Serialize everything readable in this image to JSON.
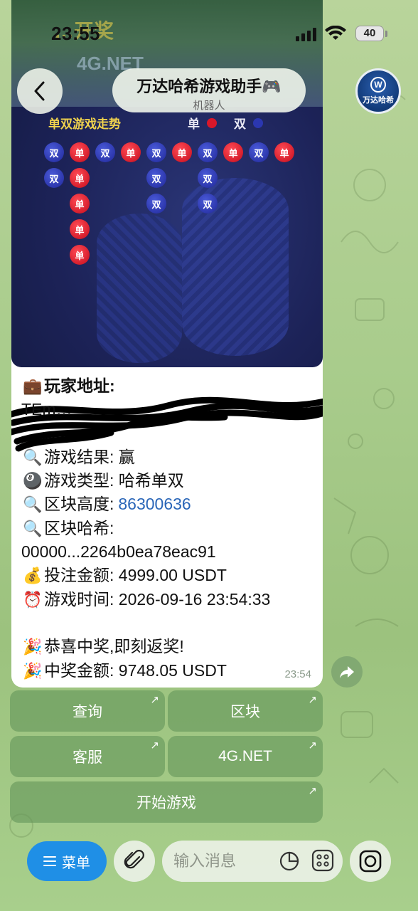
{
  "status": {
    "time": "23:55",
    "battery": "40"
  },
  "header": {
    "title": "万达哈希游戏助手🎮",
    "subtitle": "机器人",
    "avatar_text": "万达哈希"
  },
  "photo": {
    "banner": "…开奖",
    "banner_sub": "4G.NET",
    "trend_title": "单双游戏走势",
    "legend": [
      {
        "label": "单",
        "color": "#d8172a"
      },
      {
        "label": "双",
        "color": "#2b37b0"
      }
    ],
    "columns": [
      [
        "双",
        "双"
      ],
      [
        "单",
        "单",
        "单",
        "单",
        "单"
      ],
      [
        "双"
      ],
      [
        "单"
      ],
      [
        "双",
        "双",
        "双"
      ],
      [
        "单"
      ],
      [
        "双",
        "双",
        "双"
      ],
      [
        "单"
      ],
      [
        "双"
      ],
      [
        "单"
      ]
    ]
  },
  "message": {
    "player_label": "玩家地址:",
    "player_address_partial": "TEm…",
    "result": "游戏结果: 赢",
    "type": "游戏类型: 哈希单双",
    "height_label": "区块高度: ",
    "height": "86300636",
    "hash_label": "区块哈希:",
    "hash": "00000...2264b0ea78eac91",
    "bet": "投注金额: 4999.00 USDT",
    "time": "游戏时间: 2026-09-16 23:54:33",
    "congrats": "恭喜中奖,即刻返奖!",
    "prize": "中奖金额: 9748.05 USDT",
    "sent_time": "23:54"
  },
  "emoji": {
    "player": "💼",
    "result": "🔍",
    "type": "🎱",
    "height": "🔍",
    "hash": "🔍",
    "bet": "💰",
    "time": "⏰",
    "congrats": "🎉",
    "prize": "🎉"
  },
  "keyboard": {
    "query": "查询",
    "block": "区块",
    "support": "客服",
    "site": "4G.NET",
    "start": "开始游戏"
  },
  "bottom": {
    "menu_label": "菜单",
    "input_placeholder": "输入消息"
  }
}
